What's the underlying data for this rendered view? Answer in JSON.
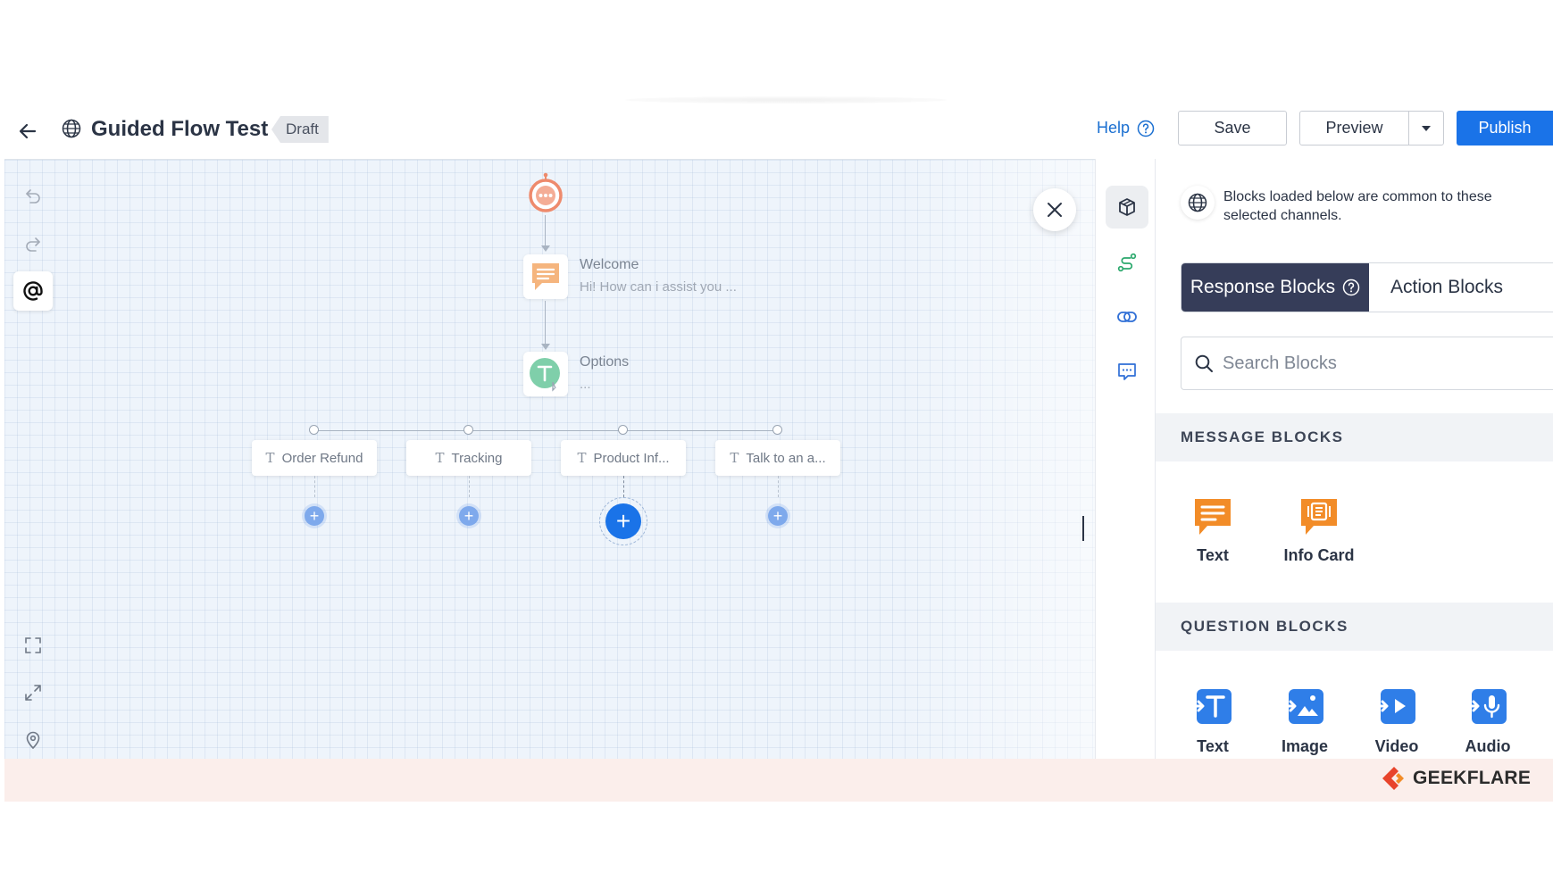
{
  "header": {
    "title": "Guided Flow Test",
    "status": "Draft",
    "help_label": "Help",
    "save_label": "Save",
    "preview_label": "Preview",
    "publish_label": "Publish"
  },
  "canvas": {
    "nodes": {
      "welcome": {
        "title": "Welcome",
        "subtitle": "Hi! How can i assist you ..."
      },
      "options": {
        "title": "Options",
        "subtitle": "..."
      }
    },
    "option_items": [
      {
        "label": "Order Refund"
      },
      {
        "label": "Tracking"
      },
      {
        "label": "Product Inf..."
      },
      {
        "label": "Talk to an a..."
      }
    ]
  },
  "panel": {
    "info_text": "Blocks loaded below are common to these selected channels.",
    "tabs": [
      {
        "label": "Response Blocks",
        "active": true
      },
      {
        "label": "Action Blocks",
        "active": false
      }
    ],
    "search_placeholder": "Search Blocks",
    "sections": [
      {
        "title": "MESSAGE BLOCKS",
        "blocks": [
          "Text",
          "Info Card"
        ]
      },
      {
        "title": "QUESTION BLOCKS",
        "blocks": [
          "Text",
          "Image",
          "Video",
          "Audio"
        ]
      }
    ]
  },
  "footer": {
    "brand": "GEEKFLARE"
  },
  "colors": {
    "accent": "#1a73e8",
    "tab_active": "#363d59",
    "message_block": "#f28c28",
    "question_block": "#2f7ee8",
    "bot_node": "#ee8a6c",
    "options_node": "#63c29a"
  }
}
